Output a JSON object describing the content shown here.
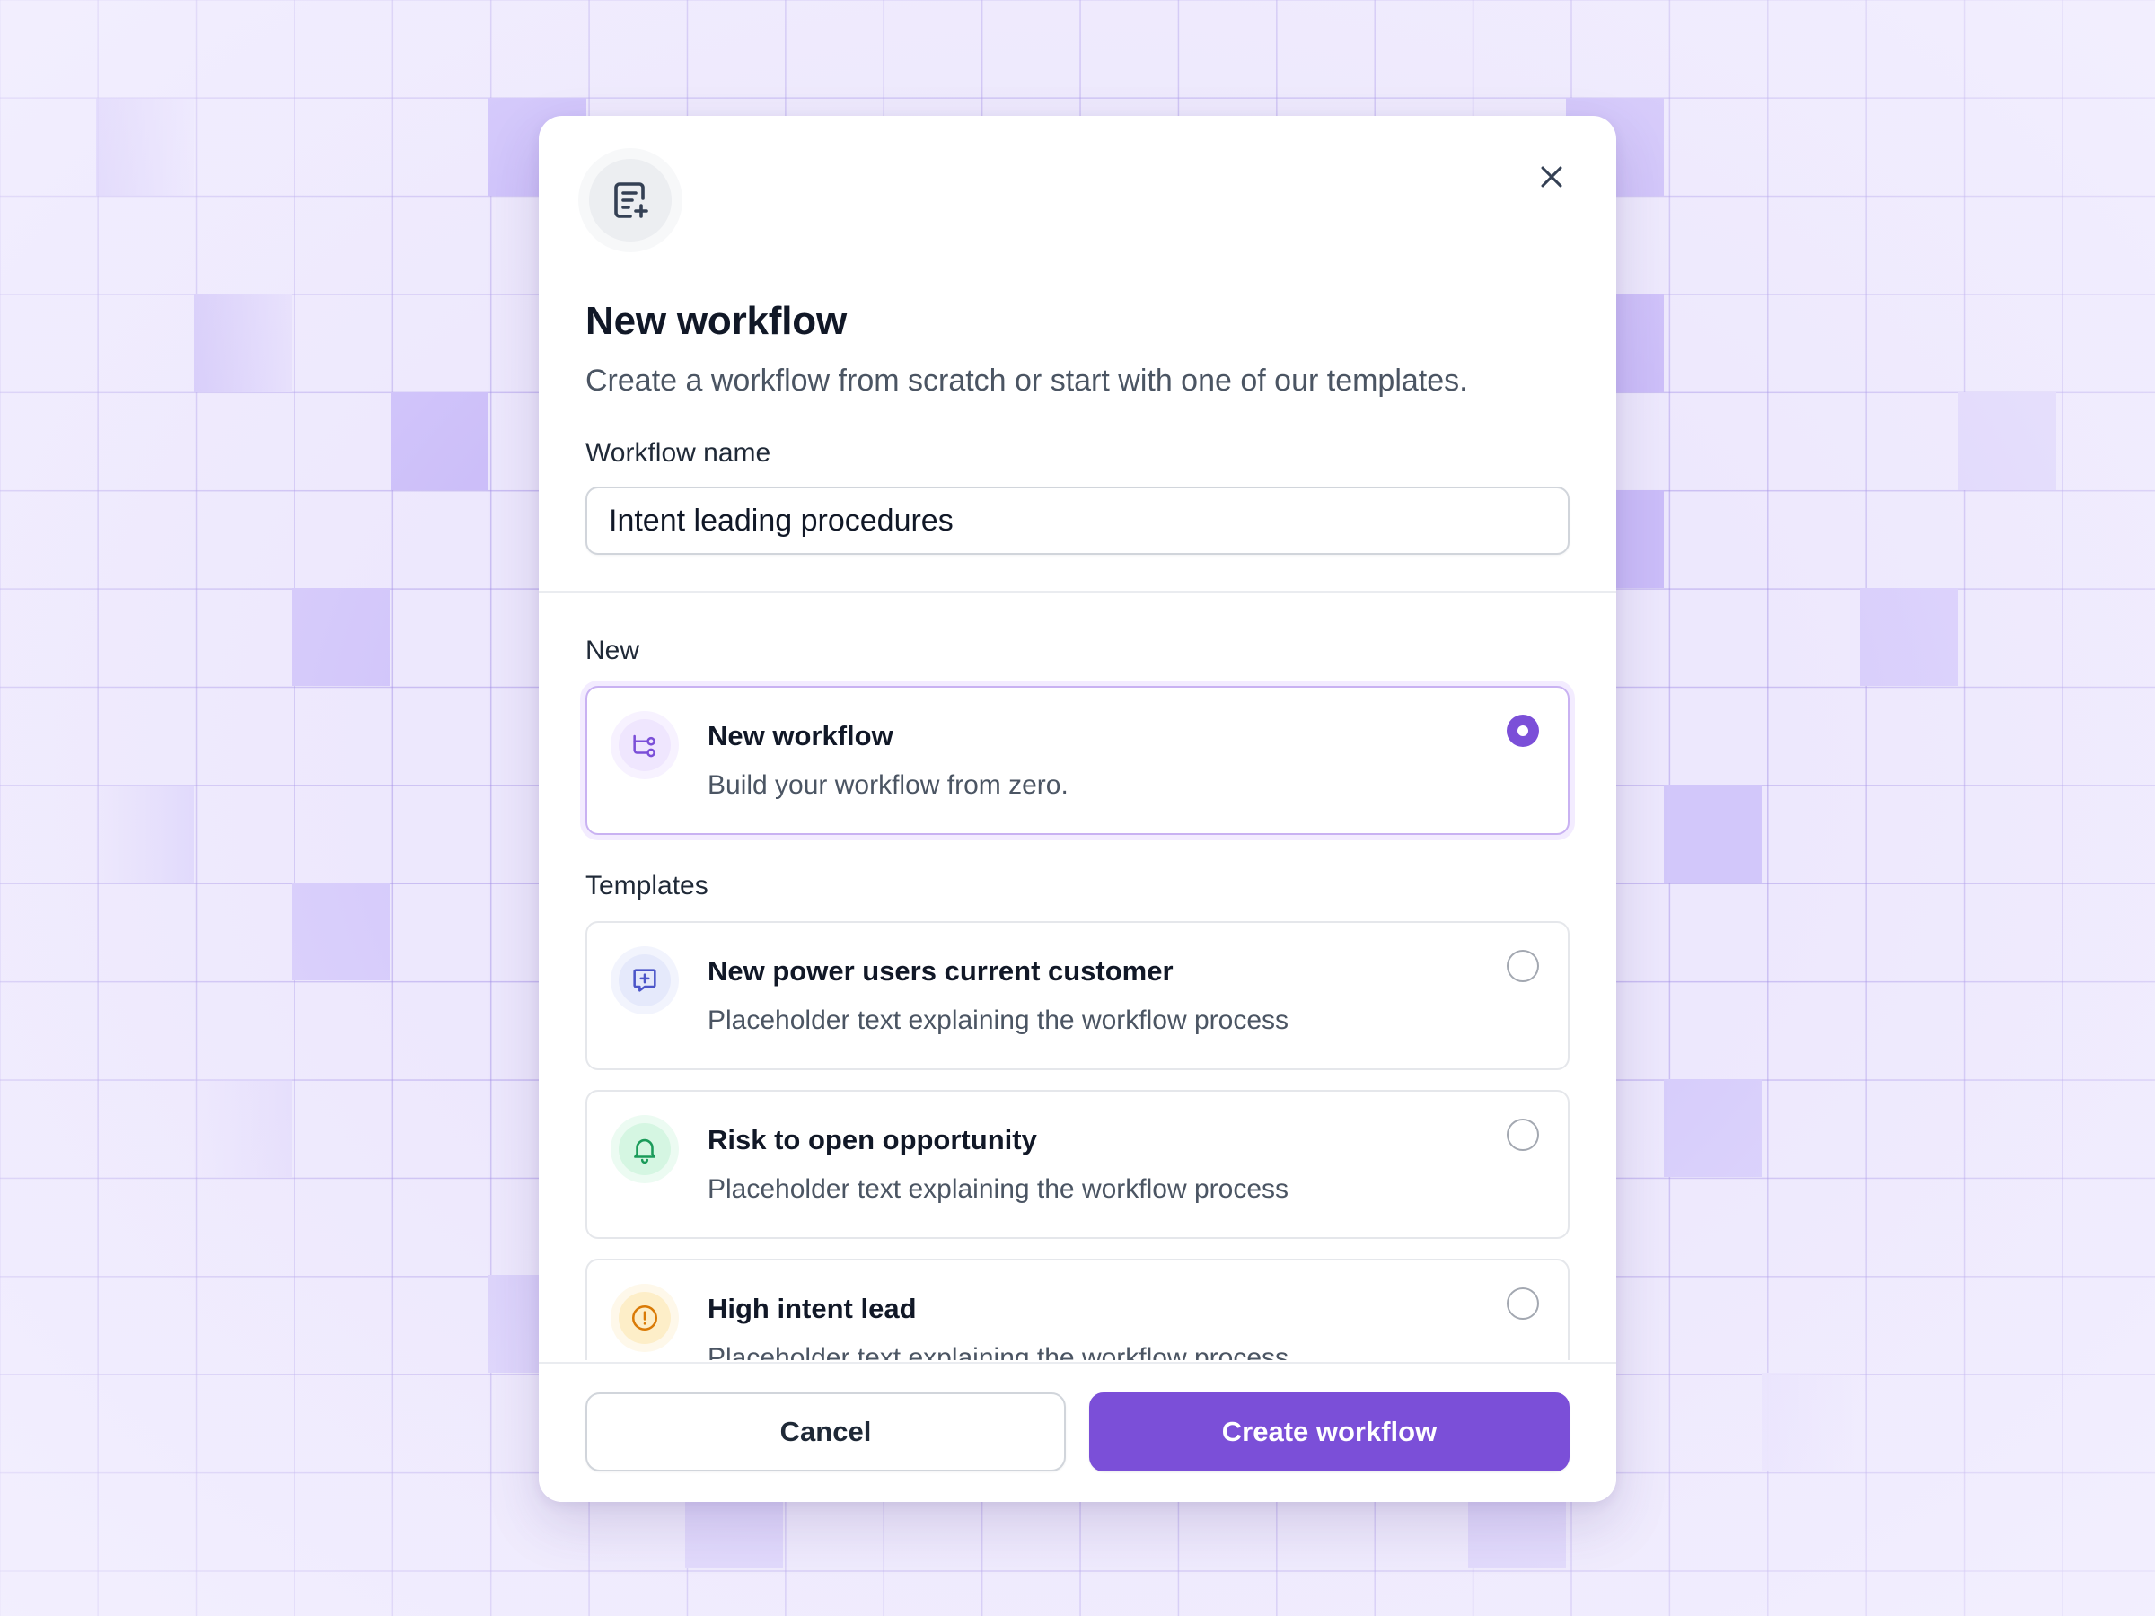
{
  "modal": {
    "title": "New workflow",
    "subtitle": "Create a workflow from scratch or start with one of our templates.",
    "header_icon": "file-plus-icon",
    "close_icon": "close-icon"
  },
  "form": {
    "name_label": "Workflow name",
    "name_value": "Intent leading procedures"
  },
  "sections": {
    "new_label": "New",
    "templates_label": "Templates"
  },
  "new_option": {
    "title": "New workflow",
    "description": "Build your workflow from zero.",
    "icon": "workflow-branch-icon",
    "selected": true
  },
  "templates": [
    {
      "title": "New power users current customer",
      "description": "Placeholder text explaining the workflow process",
      "icon": "message-plus-icon",
      "selected": false
    },
    {
      "title": "Risk to open opportunity",
      "description": "Placeholder text explaining the workflow process",
      "icon": "bell-icon",
      "selected": false
    },
    {
      "title": "High intent lead",
      "description": "Placeholder text explaining the workflow process",
      "icon": "alert-circle-icon",
      "selected": false
    }
  ],
  "footer": {
    "cancel_label": "Cancel",
    "create_label": "Create workflow"
  },
  "colors": {
    "accent": "#7b4fd8",
    "background": "#ede8fd",
    "selected_border": "#c9b2f2"
  }
}
